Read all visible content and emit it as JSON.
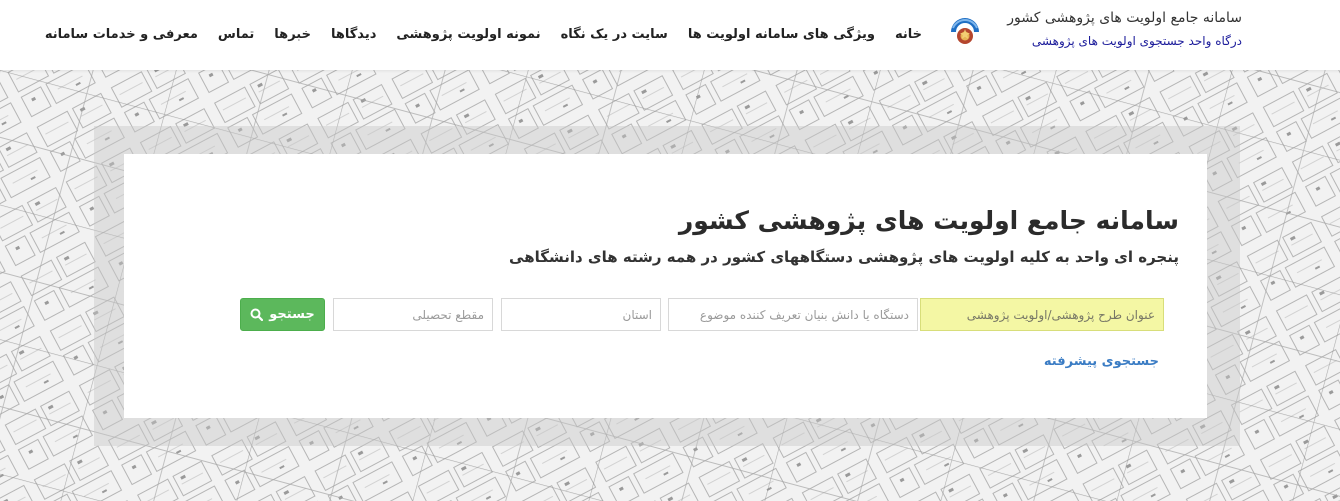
{
  "header": {
    "brand_title": "سامانه جامع اولویت های پژوهشی کشور",
    "brand_subtitle": "درگاه واحد جستجوی اولویت های پژوهشی",
    "logo_icon": "blue-crescent-emblem-logo",
    "nav": [
      {
        "label": "خانه"
      },
      {
        "label": "ویژگی های سامانه اولویت ها"
      },
      {
        "label": "سایت در یک نگاه"
      },
      {
        "label": "نمونه اولویت پژوهشی"
      },
      {
        "label": "دیدگاها"
      },
      {
        "label": "خبرها"
      },
      {
        "label": "تماس"
      },
      {
        "label": "معرفی و خدمات سامانه"
      }
    ]
  },
  "search": {
    "title": "سامانه جامع اولویت های پژوهشی کشور",
    "subtitle": "پنجره ای واحد به کلیه اولویت های پژوهشی دستگاههای کشور در همه رشته های دانشگاهی",
    "topic_placeholder": "عنوان طرح پژوهشی/اولویت پژوهشی",
    "org_placeholder": "دستگاه یا دانش بنیان تعریف کننده موضوع",
    "state_placeholder": "استان",
    "grade_placeholder": "مقطع تحصیلی",
    "button_label": "جستجو",
    "button_icon": "search-icon",
    "advanced_link": "جستجوی پیشرفته"
  },
  "colors": {
    "accent_green": "#5cb85c",
    "topic_highlight": "#f4f7a4",
    "link_blue": "#3a7cc4",
    "subtitle_navy": "#1a1a9a"
  }
}
